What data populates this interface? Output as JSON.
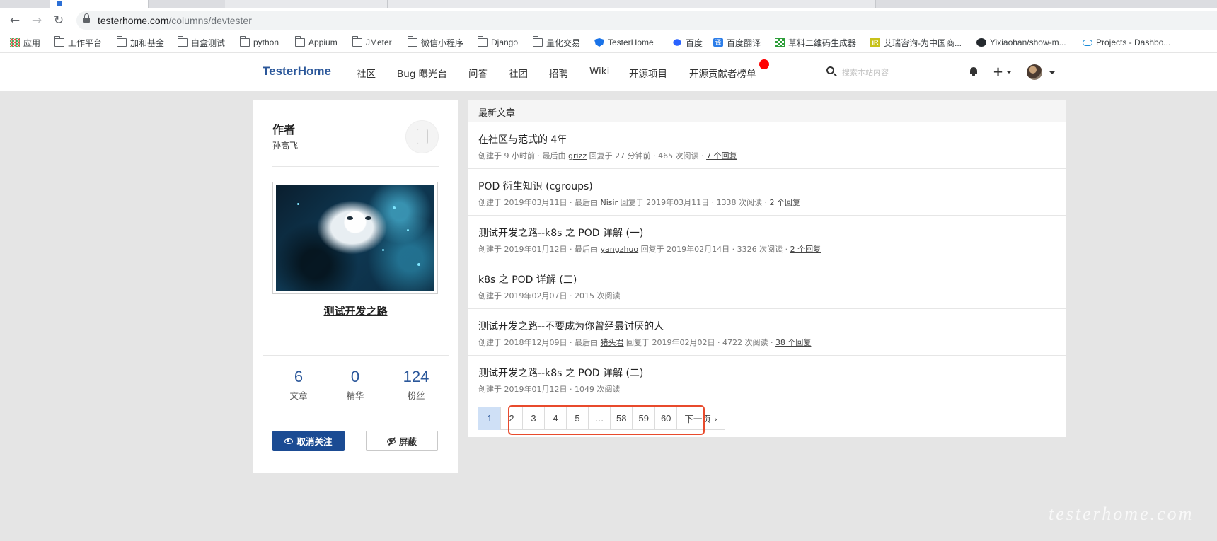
{
  "browser": {
    "url_host": "testerhome.com",
    "url_path": "/columns/devtester",
    "bookmarks": [
      {
        "label": "应用",
        "icon": "apps-grid-icon"
      },
      {
        "label": "工作平台",
        "icon": "folder-icon"
      },
      {
        "label": "加和基金",
        "icon": "folder-icon"
      },
      {
        "label": "白盒测试",
        "icon": "folder-icon"
      },
      {
        "label": "python",
        "icon": "folder-icon"
      },
      {
        "label": "Appium",
        "icon": "folder-icon"
      },
      {
        "label": "JMeter",
        "icon": "folder-icon"
      },
      {
        "label": "微信小程序",
        "icon": "folder-icon"
      },
      {
        "label": "Django",
        "icon": "folder-icon"
      },
      {
        "label": "量化交易",
        "icon": "folder-icon"
      },
      {
        "label": "TesterHome",
        "icon": "shield-icon"
      },
      {
        "label": "百度",
        "icon": "paw-icon"
      },
      {
        "label": "百度翻译",
        "icon": "translate-icon"
      },
      {
        "label": "草料二维码生成器",
        "icon": "qr-icon"
      },
      {
        "label": "艾瑞咨询-为中国商...",
        "icon": "ir-icon"
      },
      {
        "label": "Yixiaohan/show-m...",
        "icon": "github-icon"
      },
      {
        "label": "Projects - Dashbo...",
        "icon": "cloud-icon"
      }
    ]
  },
  "header": {
    "brand": "TesterHome",
    "nav": [
      "社区",
      "Bug 曝光台",
      "问答",
      "社团",
      "招聘",
      "Wiki",
      "开源项目",
      "开源贡献者榜单"
    ],
    "search_placeholder": "搜索本站内容",
    "notification_color": "#ff0000"
  },
  "author": {
    "label": "作者",
    "name": "孙高飞",
    "column_title": "测试开发之路",
    "stats": [
      {
        "value": "6",
        "label": "文章"
      },
      {
        "value": "0",
        "label": "精华"
      },
      {
        "value": "124",
        "label": "粉丝"
      }
    ],
    "unfollow_label": "取消关注",
    "block_label": "屏蔽"
  },
  "articles": {
    "header": "最新文章",
    "items": [
      {
        "title": "在社区与范式的 4年",
        "meta_prefix": "创建于 9 小时前 · 最后由 ",
        "user": "grizz",
        "meta_mid": " 回复于 27 分钟前 · 465 次阅读 · ",
        "replies": "7 个回复"
      },
      {
        "title": "POD 衍生知识 (cgroups)",
        "meta_prefix": "创建于 2019年03月11日 · 最后由 ",
        "user": "Nisir",
        "meta_mid": " 回复于 2019年03月11日 · 1338 次阅读 · ",
        "replies": "2 个回复"
      },
      {
        "title": "测试开发之路--k8s 之 POD 详解 (一)",
        "meta_prefix": "创建于 2019年01月12日 · 最后由 ",
        "user": "yangzhuo",
        "meta_mid": " 回复于 2019年02月14日 · 3326 次阅读 · ",
        "replies": "2 个回复"
      },
      {
        "title": "k8s 之 POD 详解 (三)",
        "meta_prefix": "创建于 2019年02月07日 · 2015 次阅读",
        "user": "",
        "meta_mid": "",
        "replies": ""
      },
      {
        "title": "测试开发之路--不要成为你曾经最讨厌的人",
        "meta_prefix": "创建于 2018年12月09日 · 最后由 ",
        "user": "猪头君",
        "meta_mid": " 回复于 2019年02月02日 · 4722 次阅读 · ",
        "replies": "38 个回复"
      },
      {
        "title": "测试开发之路--k8s 之 POD 详解 (二)",
        "meta_prefix": "创建于 2019年01月12日 · 1049 次阅读",
        "user": "",
        "meta_mid": "",
        "replies": ""
      }
    ]
  },
  "pagination": {
    "pages": [
      "1",
      "2",
      "3",
      "4",
      "5",
      "…",
      "58",
      "59",
      "60"
    ],
    "current": "1",
    "next_label": "下一页 ›",
    "highlight_color": "#e84a2c"
  },
  "watermark": "testerhome.com"
}
